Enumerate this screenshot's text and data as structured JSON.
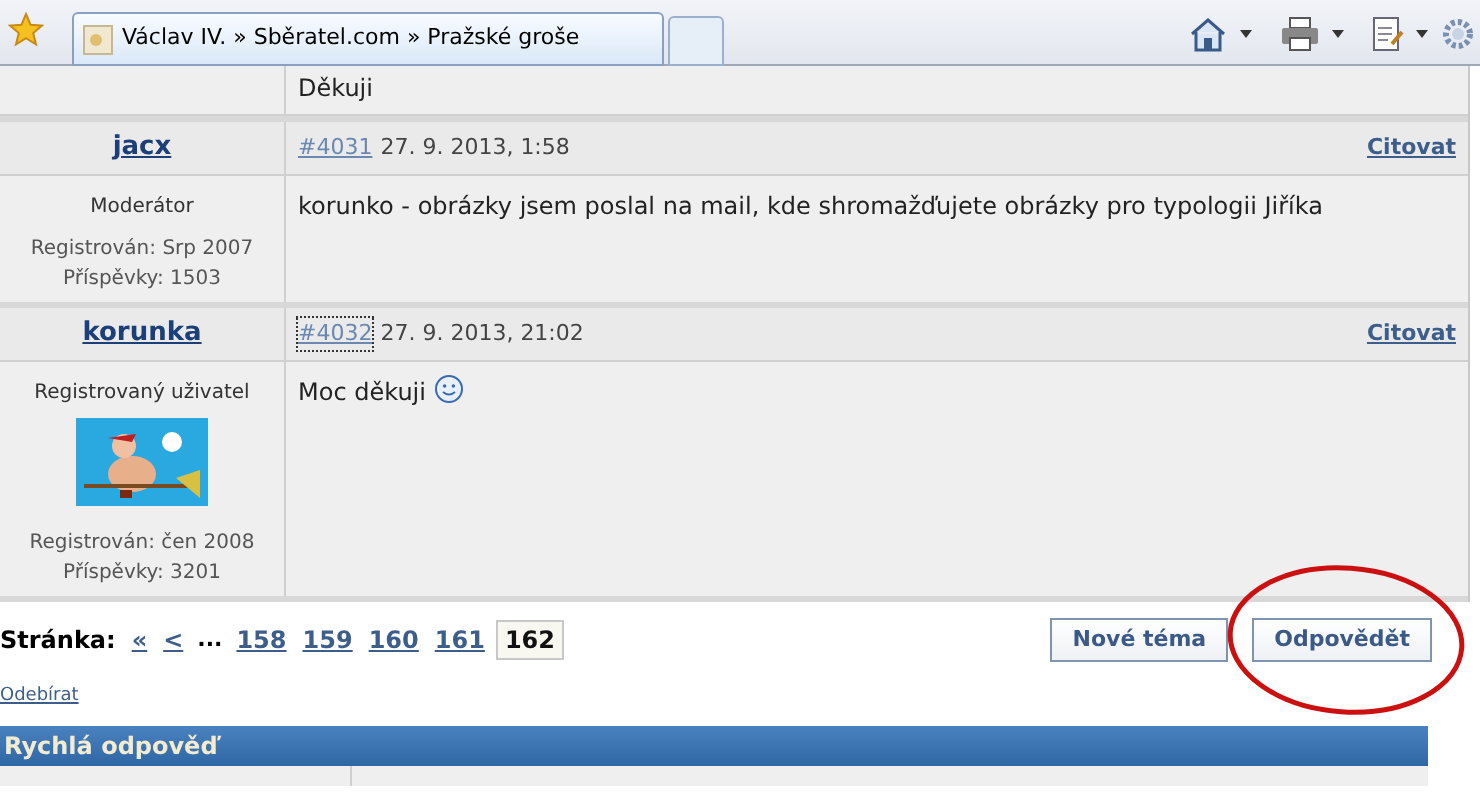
{
  "browser": {
    "tab_title": "Václav IV. » Sběratel.com » Pražské groše"
  },
  "previous_post": {
    "message": "Děkuji"
  },
  "posts": [
    {
      "author": "jacx",
      "role": "Moderátor",
      "registered": "Registrován: Srp 2007",
      "post_count": "Příspěvky: 1503",
      "number": "#4031",
      "focused": false,
      "date": "27. 9. 2013, 1:58",
      "quote": "Citovat",
      "message": "korunko - obrázky jsem poslal na mail, kde shromažďujete obrázky pro typologii Jiříka",
      "smiley": false
    },
    {
      "author": "korunka",
      "role": "Registrovaný uživatel",
      "registered": "Registrován: čen 2008",
      "post_count": "Příspěvky: 3201",
      "number": "#4032",
      "focused": true,
      "date": "27. 9. 2013, 21:02",
      "quote": "Citovat",
      "message": "Moc děkuji",
      "smiley": true
    }
  ],
  "pagination": {
    "label": "Stránka:",
    "items": [
      {
        "text": "«",
        "selected": false
      },
      {
        "text": "<",
        "selected": false
      },
      {
        "text": "...",
        "kind": "gap"
      },
      {
        "text": "158",
        "selected": false
      },
      {
        "text": "159",
        "selected": false
      },
      {
        "text": "160",
        "selected": false
      },
      {
        "text": "161",
        "selected": false
      },
      {
        "text": "162",
        "selected": true
      }
    ]
  },
  "buttons": [
    {
      "label": "Nové téma",
      "highlighted": false
    },
    {
      "label": "Odpovědět",
      "highlighted": true
    }
  ],
  "subscribe_link": "Odebírat",
  "quick_reply": {
    "title": "Rychlá odpověď"
  }
}
